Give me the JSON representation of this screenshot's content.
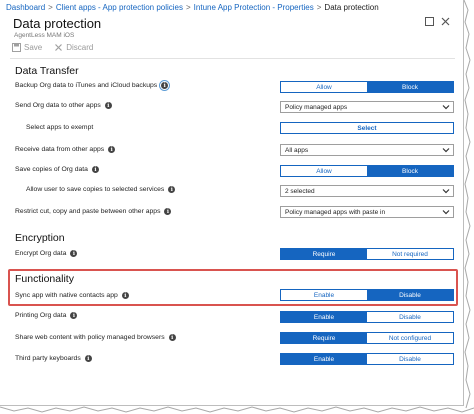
{
  "breadcrumb": {
    "items": [
      "Dashboard",
      "Client apps - App protection policies",
      "Intune App Protection - Properties"
    ],
    "current": "Data protection",
    "separator": ">"
  },
  "blade": {
    "title": "Data protection",
    "subtitle": "AgentLess MAM iOS"
  },
  "toolbar": {
    "save_label": "Save",
    "discard_label": "Discard"
  },
  "sections": {
    "data_transfer": "Data Transfer",
    "encryption": "Encryption",
    "functionality": "Functionality"
  },
  "settings": {
    "backup": {
      "label": "Backup Org data to iTunes and iCloud backups",
      "left": "Allow",
      "right": "Block",
      "selected": "right"
    },
    "send": {
      "label": "Send Org data to other apps",
      "value": "Policy managed apps"
    },
    "exempt": {
      "label": "Select apps to exempt",
      "button": "Select"
    },
    "receive": {
      "label": "Receive data from other apps",
      "value": "All apps"
    },
    "save_copies": {
      "label": "Save copies of Org data",
      "left": "Allow",
      "right": "Block",
      "selected": "right"
    },
    "allow_save": {
      "label": "Allow user to save copies to selected services",
      "value": "2 selected"
    },
    "cut_copy": {
      "label": "Restrict cut, copy and paste between other apps",
      "value": "Policy managed apps with paste in"
    },
    "encrypt": {
      "label": "Encrypt Org data",
      "left": "Require",
      "right": "Not required",
      "selected": "left"
    },
    "sync": {
      "label": "Sync app with native contacts app",
      "left": "Enable",
      "right": "Disable",
      "selected": "right"
    },
    "printing": {
      "label": "Printing Org data",
      "left": "Enable",
      "right": "Disable",
      "selected": "left"
    },
    "share_web": {
      "label": "Share web content with policy managed browsers",
      "left": "Require",
      "right": "Not configured",
      "selected": "left"
    },
    "keyboards": {
      "label": "Third party keyboards",
      "left": "Enable",
      "right": "Disable",
      "selected": "left"
    }
  },
  "icons": {
    "info": "info-icon",
    "save": "save-icon",
    "discard": "close-icon",
    "maximize": "maximize-icon",
    "close": "close-icon",
    "dropdown": "chevron-down-icon"
  },
  "colors": {
    "accent": "#1565c0",
    "highlight": "#d9534f"
  }
}
